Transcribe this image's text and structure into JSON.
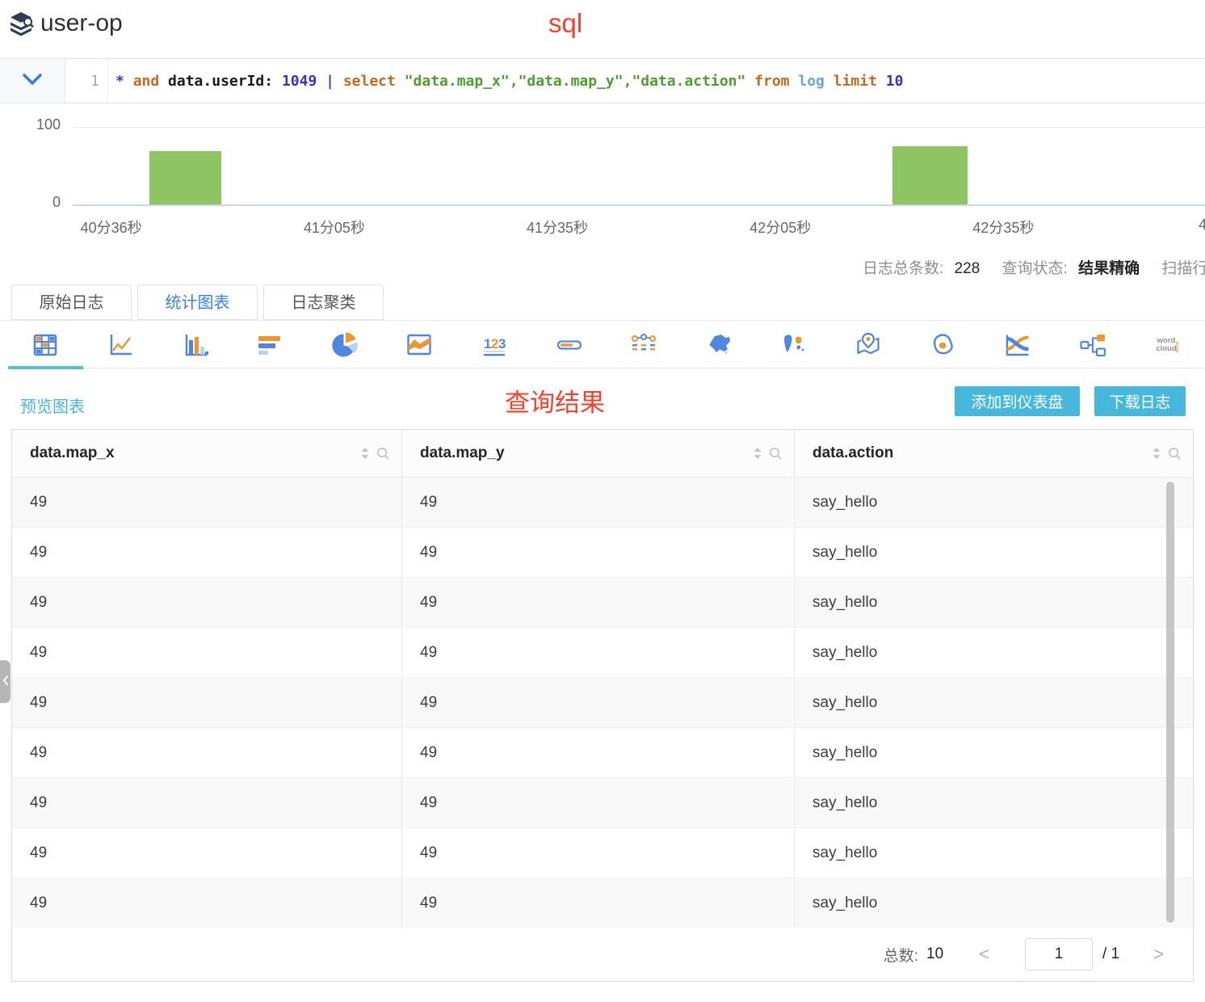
{
  "header": {
    "title": "user-op",
    "annotation": "sql"
  },
  "query_bar": {
    "line_number": "1",
    "tokens": [
      {
        "text": "* ",
        "type": "num"
      },
      {
        "text": "and",
        "type": "kw"
      },
      {
        "text": " ",
        "type": "plain"
      },
      {
        "text": "data.userId:",
        "type": "field"
      },
      {
        "text": " ",
        "type": "plain"
      },
      {
        "text": "1049",
        "type": "num"
      },
      {
        "text": " | ",
        "type": "pipe"
      },
      {
        "text": "select",
        "type": "kw"
      },
      {
        "text": " ",
        "type": "plain"
      },
      {
        "text": "\"data.map_x\",\"data.map_y\",\"data.action\"",
        "type": "str"
      },
      {
        "text": " ",
        "type": "plain"
      },
      {
        "text": "from",
        "type": "kw"
      },
      {
        "text": " ",
        "type": "plain"
      },
      {
        "text": "log",
        "type": "tbl"
      },
      {
        "text": " ",
        "type": "plain"
      },
      {
        "text": "limit",
        "type": "kw"
      },
      {
        "text": " ",
        "type": "plain"
      },
      {
        "text": "10",
        "type": "num"
      }
    ]
  },
  "chart_data": {
    "type": "bar",
    "title": "",
    "xlabel": "",
    "ylabel": "",
    "ylim": [
      0,
      100
    ],
    "yticks": [
      0,
      100
    ],
    "grid": "horizontal-only",
    "xtick_labels": [
      "40分36秒",
      "41分05秒",
      "41分35秒",
      "42分05秒",
      "42分35秒",
      "4"
    ],
    "xtick_fracs": [
      0.034,
      0.231,
      0.428,
      0.625,
      0.822,
      0.998
    ],
    "bars": [
      {
        "x_frac": 0.068,
        "w_frac": 0.063,
        "value": 69
      },
      {
        "x_frac": 0.724,
        "w_frac": 0.066,
        "value": 75
      }
    ],
    "bar_color": "#8fc463"
  },
  "status": {
    "label_total": "日志总条数:",
    "total": "228",
    "label_state": "查询状态:",
    "state": "结果精确",
    "label_scan": "扫描行"
  },
  "tabs": [
    {
      "label": "原始日志",
      "active": false
    },
    {
      "label": "统计图表",
      "active": true
    },
    {
      "label": "日志聚类",
      "active": false
    }
  ],
  "toolbar": {
    "selected_index": 0,
    "icons": [
      "table-chart",
      "line-chart",
      "column-chart",
      "bar-chart",
      "pie-chart",
      "area-chart",
      "number",
      "progress-bar",
      "sankey",
      "china-map",
      "world-map",
      "location-map",
      "heat-map",
      "flow-chart",
      "relation-graph",
      "word-cloud"
    ]
  },
  "result_header": {
    "preview": "预览图表",
    "annotation": "查询结果",
    "add_dashboard_button": "添加到仪表盘",
    "download_button": "下载日志"
  },
  "table": {
    "columns": [
      "data.map_x",
      "data.map_y",
      "data.action"
    ],
    "rows": [
      [
        "49",
        "49",
        "say_hello"
      ],
      [
        "49",
        "49",
        "say_hello"
      ],
      [
        "49",
        "49",
        "say_hello"
      ],
      [
        "49",
        "49",
        "say_hello"
      ],
      [
        "49",
        "49",
        "say_hello"
      ],
      [
        "49",
        "49",
        "say_hello"
      ],
      [
        "49",
        "49",
        "say_hello"
      ],
      [
        "49",
        "49",
        "say_hello"
      ],
      [
        "49",
        "49",
        "say_hello"
      ]
    ]
  },
  "pagination": {
    "total_label": "总数:",
    "total": "10",
    "prev": "<",
    "page_value": "1",
    "page_total": "/ 1",
    "next": ">"
  },
  "colors": {
    "annotation_red": "#f5402c",
    "button_cyan": "#47b8dc",
    "active_tab_blue": "#3c80e0",
    "bar_green": "#8fc463",
    "link_cyan": "#49b4d6",
    "selected_underline_teal": "#4fc3cf",
    "toolbar_blue": "#4f86e0",
    "toolbar_orange": "#f0962f",
    "toolbar_lightblue": "#b9d2f2"
  }
}
